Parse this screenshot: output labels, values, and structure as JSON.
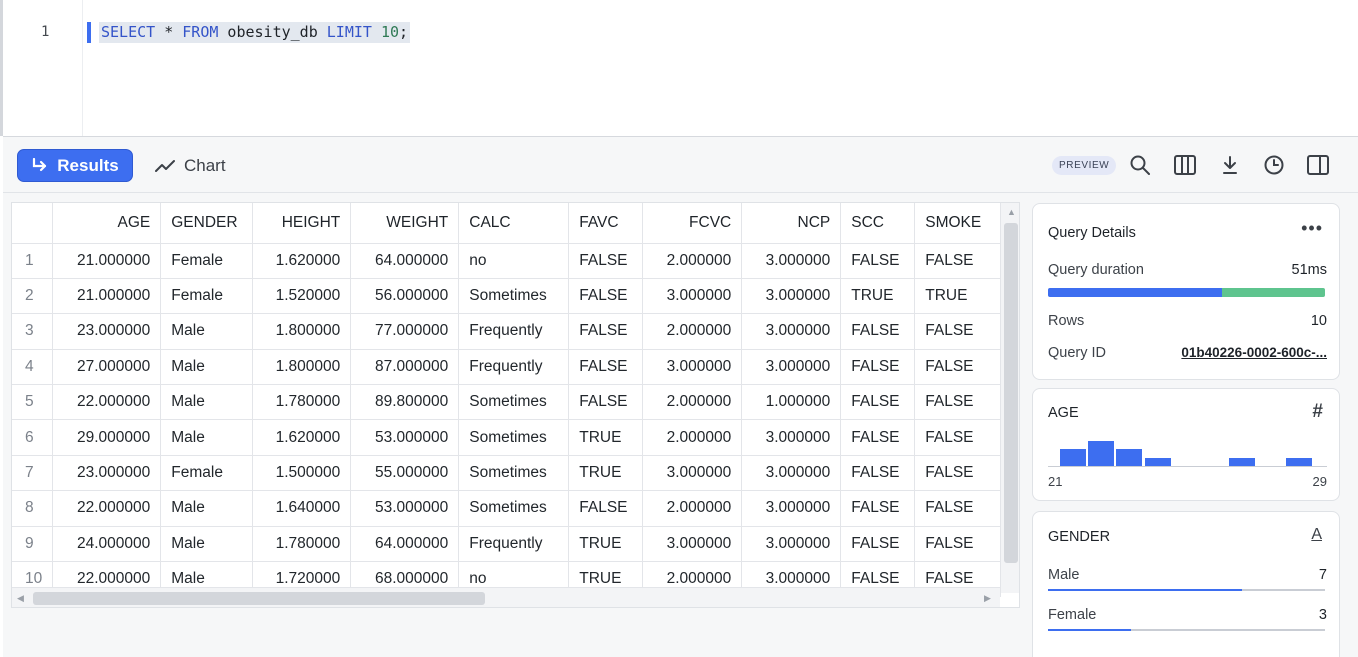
{
  "editor": {
    "line_number": "1",
    "sql": {
      "kw1": "SELECT",
      "star": " * ",
      "kw2": "FROM",
      "table": " obesity_db ",
      "kw3": "LIMIT",
      "limit": " 10",
      "end": ";"
    }
  },
  "toolbar": {
    "results_label": "Results",
    "chart_label": "Chart",
    "preview_badge": "PREVIEW",
    "icons": [
      "search-icon",
      "columns-icon",
      "download-icon",
      "history-icon",
      "split-panel-icon"
    ]
  },
  "table": {
    "columns": [
      "AGE",
      "GENDER",
      "HEIGHT",
      "WEIGHT",
      "CALC",
      "FAVC",
      "FCVC",
      "NCP",
      "SCC",
      "SMOKE"
    ],
    "rows": [
      [
        "1",
        "21.000000",
        "Female",
        "1.620000",
        "64.000000",
        "no",
        "FALSE",
        "2.000000",
        "3.000000",
        "FALSE",
        "FALSE"
      ],
      [
        "2",
        "21.000000",
        "Female",
        "1.520000",
        "56.000000",
        "Sometimes",
        "FALSE",
        "3.000000",
        "3.000000",
        "TRUE",
        "TRUE"
      ],
      [
        "3",
        "23.000000",
        "Male",
        "1.800000",
        "77.000000",
        "Frequently",
        "FALSE",
        "2.000000",
        "3.000000",
        "FALSE",
        "FALSE"
      ],
      [
        "4",
        "27.000000",
        "Male",
        "1.800000",
        "87.000000",
        "Frequently",
        "FALSE",
        "3.000000",
        "3.000000",
        "FALSE",
        "FALSE"
      ],
      [
        "5",
        "22.000000",
        "Male",
        "1.780000",
        "89.800000",
        "Sometimes",
        "FALSE",
        "2.000000",
        "1.000000",
        "FALSE",
        "FALSE"
      ],
      [
        "6",
        "29.000000",
        "Male",
        "1.620000",
        "53.000000",
        "Sometimes",
        "TRUE",
        "2.000000",
        "3.000000",
        "FALSE",
        "FALSE"
      ],
      [
        "7",
        "23.000000",
        "Female",
        "1.500000",
        "55.000000",
        "Sometimes",
        "TRUE",
        "3.000000",
        "3.000000",
        "FALSE",
        "FALSE"
      ],
      [
        "8",
        "22.000000",
        "Male",
        "1.640000",
        "53.000000",
        "Sometimes",
        "FALSE",
        "2.000000",
        "3.000000",
        "FALSE",
        "FALSE"
      ],
      [
        "9",
        "24.000000",
        "Male",
        "1.780000",
        "64.000000",
        "Frequently",
        "TRUE",
        "3.000000",
        "3.000000",
        "FALSE",
        "FALSE"
      ],
      [
        "10",
        "22.000000",
        "Male",
        "1.720000",
        "68.000000",
        "no",
        "TRUE",
        "2.000000",
        "3.000000",
        "FALSE",
        "FALSE"
      ]
    ]
  },
  "query_details": {
    "title": "Query Details",
    "more_icon": "more-horizontal-icon",
    "duration_label": "Query duration",
    "duration_value": "51ms",
    "duration_split": [
      0.627,
      0.373
    ],
    "duration_colors": [
      "#3d6ef0",
      "#5ec48e"
    ],
    "rows_label": "Rows",
    "rows_value": "10",
    "query_id_label": "Query ID",
    "query_id_value": "01b40226-0002-600c-..."
  },
  "age_card": {
    "title": "AGE",
    "type_icon": "hash-icon",
    "histogram_counts": [
      2,
      3,
      2,
      1,
      0,
      0,
      1,
      0,
      1
    ],
    "min_label": "21",
    "max_label": "29"
  },
  "gender_card": {
    "title": "GENDER",
    "type_icon": "text-type-icon",
    "type_glyph": "A",
    "items": [
      {
        "label": "Male",
        "value": "7",
        "fraction": 0.7
      },
      {
        "label": "Female",
        "value": "3",
        "fraction": 0.3
      }
    ]
  }
}
